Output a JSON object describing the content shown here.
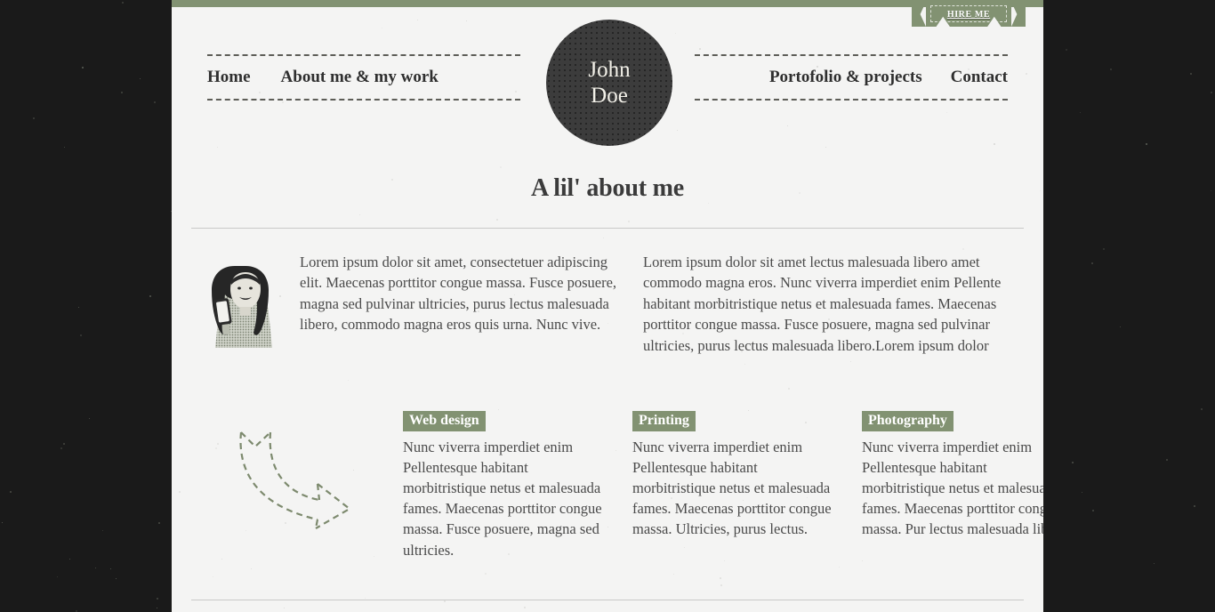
{
  "theme": {
    "accent_green": "#829272",
    "panel_bg": "#f4f4f3",
    "backdrop": "#1a1a1a",
    "badge_bg": "#3c3c3c",
    "text": "#4a4a4a",
    "rule": "#c9c9c7"
  },
  "ribbon": {
    "label": "HIRE ME"
  },
  "brand": {
    "line1": "John",
    "line2": "Doe"
  },
  "nav": {
    "left": [
      {
        "label": "Home"
      },
      {
        "label": "About me & my work"
      }
    ],
    "right": [
      {
        "label": "Portofolio & projects"
      },
      {
        "label": "Contact"
      }
    ]
  },
  "main": {
    "title": "A lil' about me",
    "photo_alt": "woman-holding-phone-photo",
    "intro": {
      "column_1": "Lorem ipsum dolor sit amet, consectetuer adipiscing elit. Maecenas porttitor congue massa. Fusce posuere, magna sed pulvinar ultricies, purus lectus malesuada libero, commodo magna eros quis urna. Nunc vive.",
      "column_2": "Lorem ipsum dolor sit amet lectus malesuada libero amet commodo magna eros. Nunc viverra imperdiet enim Pellente habitant morbitristique netus et malesuada fames. Maecenas porttitor congue massa. Fusce posuere, magna sed pulvinar ultricies, purus lectus malesuada libero.Lorem ipsum dolor"
    },
    "services": [
      {
        "tag": "Web design",
        "text": "Nunc viverra imperdiet enim Pellentesque habitant morbitristique netus et malesuada fames. Maecenas porttitor congue massa. Fusce posuere, magna sed ultricies."
      },
      {
        "tag": "Printing",
        "text": "Nunc viverra imperdiet enim Pellentesque habitant morbitristique netus et malesuada fames. Maecenas porttitor congue massa. Ultricies, purus lectus."
      },
      {
        "tag": "Photography",
        "text": "Nunc viverra imperdiet enim Pellentesque habitant morbitristique netus et malesuada fames. Maecenas porttitor congue massa. Pur lectus malesuada libero."
      }
    ],
    "arrow_alt": "dashed-curved-arrow"
  }
}
